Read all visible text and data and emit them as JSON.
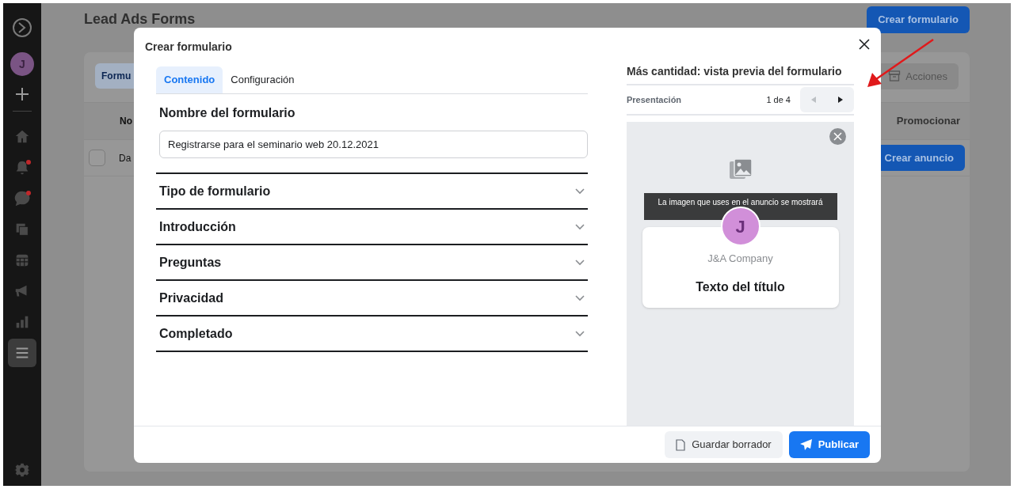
{
  "sidebar": {
    "avatar": "J",
    "items": [
      {
        "kind": "home",
        "notification": false,
        "selected": false
      },
      {
        "kind": "bell",
        "notification": true,
        "selected": false
      },
      {
        "kind": "chat",
        "notification": true,
        "selected": false
      },
      {
        "kind": "pages",
        "notification": false,
        "selected": false
      },
      {
        "kind": "calendar",
        "notification": false,
        "selected": false
      },
      {
        "kind": "megaphone",
        "notification": false,
        "selected": false
      },
      {
        "kind": "chart",
        "notification": false,
        "selected": false
      },
      {
        "kind": "menu",
        "notification": false,
        "selected": true
      }
    ]
  },
  "page": {
    "title": "Lead Ads Forms",
    "create_button": "Crear formulario",
    "tabs": [
      {
        "label": "Formu",
        "selected": true
      }
    ],
    "actions_button": "Acciones",
    "table": {
      "columns": [
        "No",
        "Promocionar"
      ],
      "rows": [
        {
          "checked": false,
          "cells": [
            "Da"
          ],
          "action": "Crear anuncio"
        }
      ]
    }
  },
  "modal": {
    "title": "Crear formulario",
    "tabs": [
      {
        "label": "Contenido",
        "selected": true
      },
      {
        "label": "Configuración",
        "selected": false
      }
    ],
    "name_label": "Nombre del formulario",
    "name_value": "Registrarse para el seminario web 20.12.2021",
    "sections": [
      {
        "label": "Tipo de formulario",
        "expanded": false
      },
      {
        "label": "Introducción",
        "expanded": false
      },
      {
        "label": "Preguntas",
        "expanded": false
      },
      {
        "label": "Privacidad",
        "expanded": false
      },
      {
        "label": "Completado",
        "expanded": false
      }
    ],
    "preview": {
      "title": "Más cantidad: vista previa del formulario",
      "step_label": "Presentación",
      "page": "1 de 4",
      "prev_disabled": true,
      "next_disabled": false,
      "image_hint": "La imagen que uses en el anuncio se mostrará",
      "avatar": "J",
      "company": "J&A Company",
      "headline": "Texto del título"
    },
    "buttons": [
      {
        "label": "Guardar borrador",
        "kind": "secondary"
      },
      {
        "label": "Publicar",
        "kind": "primary"
      }
    ]
  }
}
